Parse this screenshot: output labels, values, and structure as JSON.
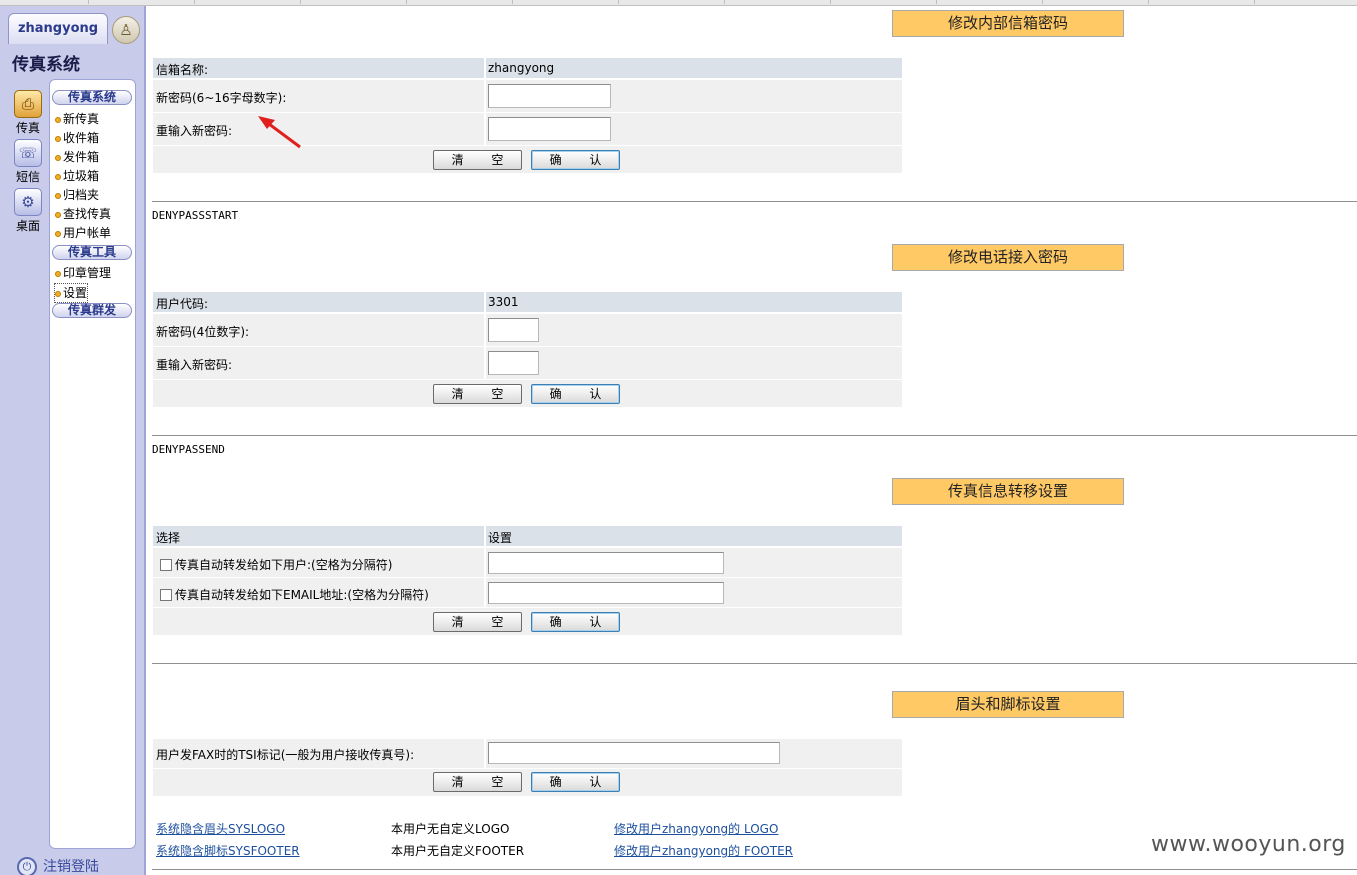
{
  "sidebar": {
    "username": "zhangyong",
    "title": "传真系统",
    "side_buttons": [
      {
        "label": "传真",
        "icon": "fax-icon"
      },
      {
        "label": "短信",
        "icon": "mobile-phone-icon"
      },
      {
        "label": "桌面",
        "icon": "desktop-gear-icon"
      }
    ],
    "groups": [
      {
        "label": "传真系统",
        "items": [
          "新传真",
          "收件箱",
          "发件箱",
          "垃圾箱",
          "归档夹",
          "查找传真",
          "用户帐单"
        ]
      },
      {
        "label": "传真工具",
        "items": [
          "印章管理",
          "设置"
        ]
      },
      {
        "label": "传真群发",
        "items": []
      }
    ],
    "selected_item": "设置",
    "logout_label": "注销登陆"
  },
  "mailbox_section": {
    "title": "修改内部信箱密码",
    "name_label": "信箱名称:",
    "name_value": "zhangyong",
    "new_pwd_label": "新密码(6~16字母数字):",
    "new_pwd_value": "",
    "confirm_pwd_label": "重输入新密码:",
    "confirm_pwd_value": "",
    "clear_label": "清 空",
    "ok_label": "确 认"
  },
  "marker_start": "DENYPASSSTART",
  "phone_section": {
    "title": "修改电话接入密码",
    "code_label": "用户代码:",
    "code_value": "3301",
    "new_pwd_label": "新密码(4位数字):",
    "new_pwd_value": "",
    "confirm_pwd_label": "重输入新密码:",
    "confirm_pwd_value": "",
    "clear_label": "清 空",
    "ok_label": "确 认"
  },
  "marker_end": "DENYPASSEND",
  "forward_section": {
    "title": "传真信息转移设置",
    "col_select": "选择",
    "col_settings": "设置",
    "forward_users_label": "传真自动转发给如下用户:(空格为分隔符)",
    "forward_users_checked": false,
    "forward_users_value": "",
    "forward_email_label": "传真自动转发给如下EMAIL地址:(空格为分隔符)",
    "forward_email_checked": false,
    "forward_email_value": "",
    "clear_label": "清 空",
    "ok_label": "确 认"
  },
  "header_footer_section": {
    "title": "眉头和脚标设置",
    "tsi_label": "用户发FAX时的TSI标记(一般为用户接收传真号):",
    "tsi_value": "",
    "clear_label": "清 空",
    "ok_label": "确 认",
    "rows": [
      {
        "sys_link": "系统隐含眉头SYSLOGO",
        "status": "本用户无自定义LOGO",
        "edit_link": "修改用户zhangyong的 LOGO"
      },
      {
        "sys_link": "系统隐含脚标SYSFOOTER",
        "status": "本用户无自定义FOOTER",
        "edit_link": "修改用户zhangyong的 FOOTER"
      }
    ]
  },
  "watermark": "www.wooyun.org",
  "colors": {
    "section_title_bg": "#ffc966",
    "row_bg": "#f0f0f0",
    "header_row_bg": "#dbe1e8",
    "annotation_arrow": "#e0201c"
  }
}
